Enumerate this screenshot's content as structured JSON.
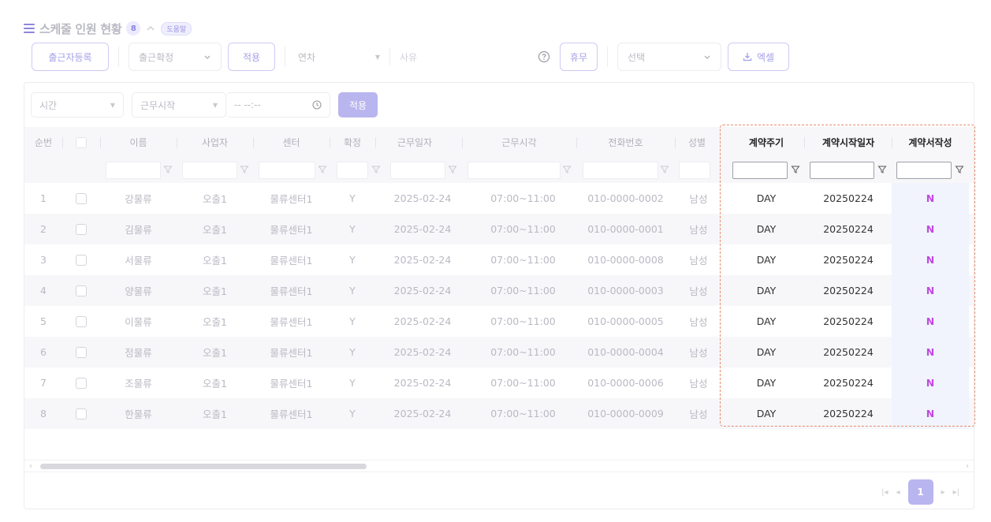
{
  "header": {
    "title": "스케줄 인원 현황",
    "count": "8",
    "help_label": "도움말"
  },
  "toolbar": {
    "register_label": "출근자등록",
    "confirm_select": "출근확정",
    "apply_label": "적용",
    "year_select": "연차",
    "reason_placeholder": "사유",
    "leave_label": "휴무",
    "choice_select": "선택",
    "excel_label": "엑셀"
  },
  "filter": {
    "time_select": "시간",
    "start_select": "근무시작",
    "time_placeholder": "-- --:--",
    "apply_label": "적용"
  },
  "columns": [
    "순번",
    "이름",
    "사업자",
    "센터",
    "확정",
    "근무일자",
    "근무시각",
    "전화번호",
    "성별",
    "계약주기",
    "계약시작일자",
    "계약서작성"
  ],
  "rows": [
    [
      "1",
      "강물류",
      "오출1",
      "물류센터1",
      "Y",
      "2025-02-24",
      "07:00~11:00",
      "010-0000-0002",
      "남성",
      "DAY",
      "20250224",
      "N"
    ],
    [
      "2",
      "김물류",
      "오출1",
      "물류센터1",
      "Y",
      "2025-02-24",
      "07:00~11:00",
      "010-0000-0001",
      "남성",
      "DAY",
      "20250224",
      "N"
    ],
    [
      "3",
      "서물류",
      "오출1",
      "물류센터1",
      "Y",
      "2025-02-24",
      "07:00~11:00",
      "010-0000-0008",
      "남성",
      "DAY",
      "20250224",
      "N"
    ],
    [
      "4",
      "양물류",
      "오출1",
      "물류센터1",
      "Y",
      "2025-02-24",
      "07:00~11:00",
      "010-0000-0003",
      "남성",
      "DAY",
      "20250224",
      "N"
    ],
    [
      "5",
      "이물류",
      "오출1",
      "물류센터1",
      "Y",
      "2025-02-24",
      "07:00~11:00",
      "010-0000-0005",
      "남성",
      "DAY",
      "20250224",
      "N"
    ],
    [
      "6",
      "정물류",
      "오출1",
      "물류센터1",
      "Y",
      "2025-02-24",
      "07:00~11:00",
      "010-0000-0004",
      "남성",
      "DAY",
      "20250224",
      "N"
    ],
    [
      "7",
      "조물류",
      "오출1",
      "물류센터1",
      "Y",
      "2025-02-24",
      "07:00~11:00",
      "010-0000-0006",
      "남성",
      "DAY",
      "20250224",
      "N"
    ],
    [
      "8",
      "한물류",
      "오출1",
      "물류센터1",
      "Y",
      "2025-02-24",
      "07:00~11:00",
      "010-0000-0009",
      "남성",
      "DAY",
      "20250224",
      "N"
    ]
  ],
  "pagination": {
    "current_page": "1"
  },
  "colors": {
    "accent": "#b9b5ee",
    "highlight_border": "#e88b6b",
    "n_flag": "#c04ae0"
  }
}
